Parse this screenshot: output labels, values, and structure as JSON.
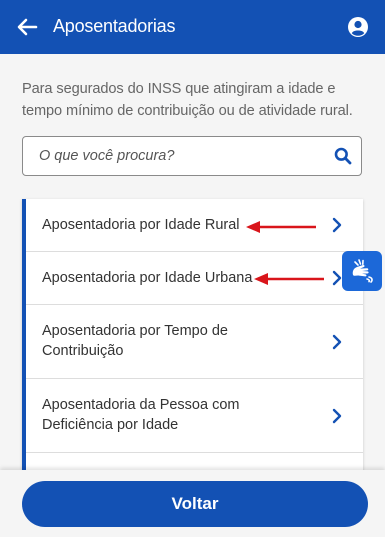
{
  "header": {
    "title": "Aposentadorias",
    "back_icon": "arrow-left-icon",
    "account_icon": "user-circle-icon",
    "color": "#1351b4"
  },
  "intro_text": "Para segurados do INSS que atingiram a idade e tempo mínimo de contribuição ou de atividade rural.",
  "search": {
    "placeholder": "O que você procura?",
    "value": "",
    "icon": "search-icon"
  },
  "list": {
    "items": [
      {
        "label": "Aposentadoria por Idade Rural",
        "annotated": true
      },
      {
        "label": "Aposentadoria por Idade Urbana",
        "annotated": true
      },
      {
        "label": "Aposentadoria por Tempo de Contribuição",
        "annotated": false
      },
      {
        "label": "Aposentadoria da Pessoa com Deficiência por Idade",
        "annotated": false
      },
      {
        "label": "",
        "annotated": false
      }
    ],
    "chevron_icon": "chevron-right-icon"
  },
  "annotation_color": "#d9151b",
  "accessibility": {
    "icon": "sign-language-icon",
    "color": "#1c68d8"
  },
  "footer": {
    "button_label": "Voltar"
  }
}
